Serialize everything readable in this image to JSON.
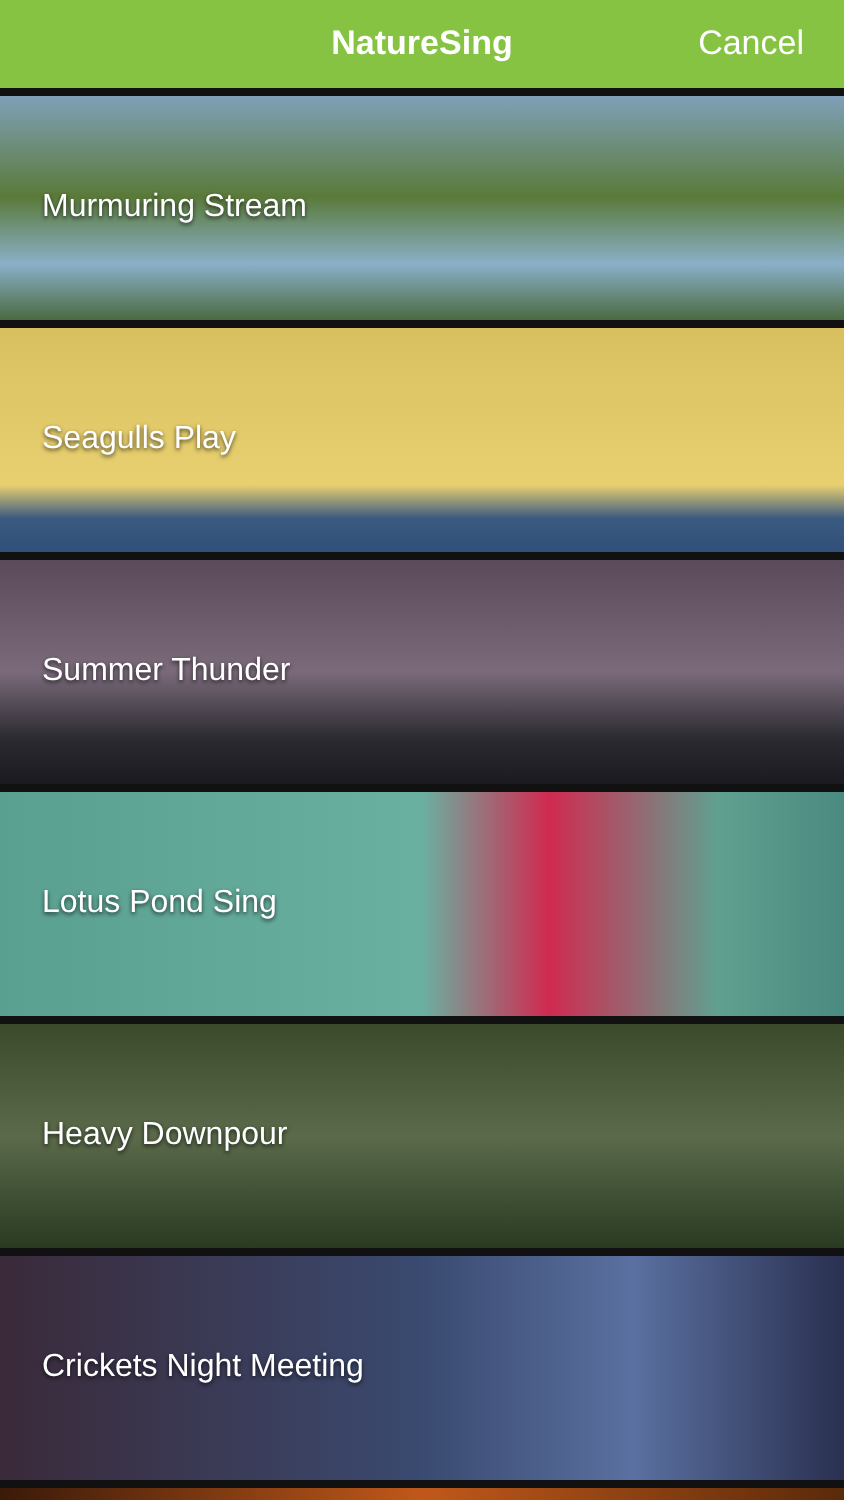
{
  "header": {
    "title": "NatureSing",
    "cancel": "Cancel"
  },
  "sounds": [
    {
      "label": "Murmuring Stream"
    },
    {
      "label": "Seagulls Play"
    },
    {
      "label": "Summer Thunder"
    },
    {
      "label": "Lotus Pond Sing"
    },
    {
      "label": "Heavy Downpour"
    },
    {
      "label": "Crickets Night Meeting"
    }
  ]
}
